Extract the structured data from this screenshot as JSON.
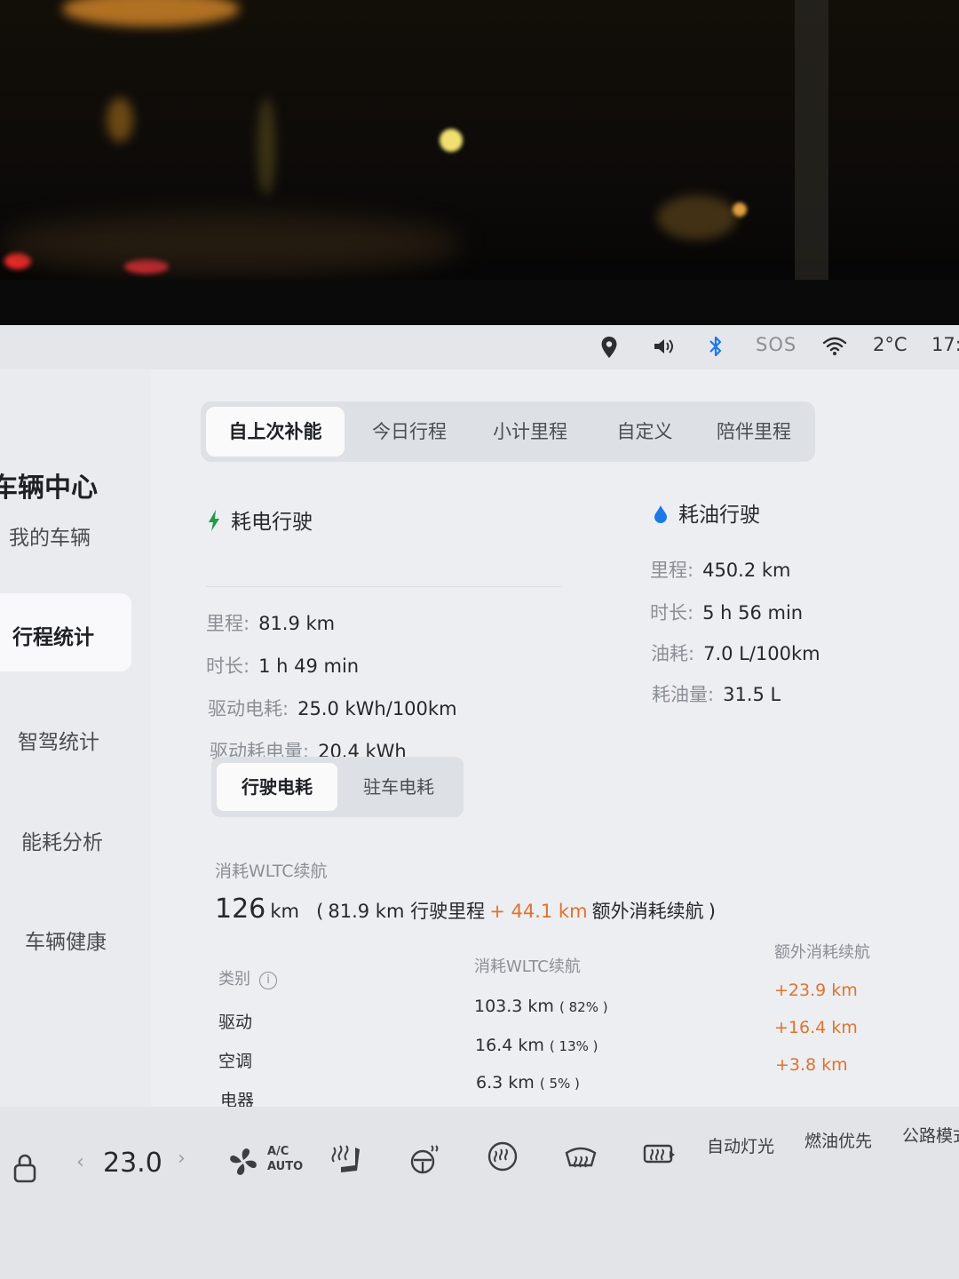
{
  "status_bar": {
    "icons": [
      "location-icon",
      "volume-icon",
      "bluetooth-icon",
      "wifi-icon"
    ],
    "sos": "SOS",
    "temperature": "2°C",
    "time": "17:"
  },
  "sidebar": {
    "title": "车辆中心",
    "items": [
      {
        "label": "我的车辆"
      },
      {
        "label": "行程统计"
      },
      {
        "label": "智驾统计"
      },
      {
        "label": "能耗分析"
      },
      {
        "label": "车辆健康"
      }
    ],
    "active_item": "行程统计"
  },
  "tabs": [
    {
      "label": "自上次补能"
    },
    {
      "label": "今日行程"
    },
    {
      "label": "小计里程"
    },
    {
      "label": "自定义"
    },
    {
      "label": "陪伴里程"
    }
  ],
  "active_tab": "自上次补能",
  "electric": {
    "title": "耗电行驶",
    "rows": [
      {
        "label": "里程:",
        "value": "81.9 km"
      },
      {
        "label": "时长:",
        "value": "1 h 49 min"
      },
      {
        "label": "驱动电耗:",
        "value": "25.0 kWh/100km"
      },
      {
        "label": "驱动耗电量:",
        "value": "20.4 kWh"
      }
    ]
  },
  "fuel": {
    "title": "耗油行驶",
    "rows": [
      {
        "label": "里程:",
        "value": "450.2 km"
      },
      {
        "label": "时长:",
        "value": "5 h 56 min"
      },
      {
        "label": "油耗:",
        "value": "7.0 L/100km"
      },
      {
        "label": "耗油量:",
        "value": "31.5 L"
      }
    ]
  },
  "sub_tabs": [
    {
      "label": "行驶电耗"
    },
    {
      "label": "驻车电耗"
    }
  ],
  "active_sub_tab": "行驶电耗",
  "wltc": {
    "label": "消耗WLTC续航",
    "total": "126",
    "unit": "km",
    "open_paren": "(",
    "driving": "81.9 km 行驶里程",
    "extra_value": "+ 44.1 km",
    "extra_label": "额外消耗续航",
    "close_paren": ")"
  },
  "table": {
    "headers": [
      "类别",
      "消耗WLTC续航",
      "额外消耗续航"
    ],
    "rows": [
      {
        "category": "驱动",
        "wltc": "103.3 km",
        "percent": "( 82% )",
        "extra": "+23.9 km"
      },
      {
        "category": "空调",
        "wltc": "16.4 km",
        "percent": "( 13% )",
        "extra": "+16.4 km"
      },
      {
        "category": "电器",
        "wltc": "6.3 km",
        "percent": "( 5% )",
        "extra": "+3.8 km"
      }
    ]
  },
  "bottom_bar": {
    "temperature": "23.0",
    "left_chevron": "‹",
    "right_chevron": "›",
    "ac_line1": "A/C",
    "ac_line2": "AUTO",
    "buttons": [
      "自动灯光",
      "燃油优先",
      "公路模式"
    ]
  },
  "colors": {
    "accent_green": "#1f9a4a",
    "accent_blue": "#1e78e8",
    "extra_orange": "#e0722e"
  }
}
